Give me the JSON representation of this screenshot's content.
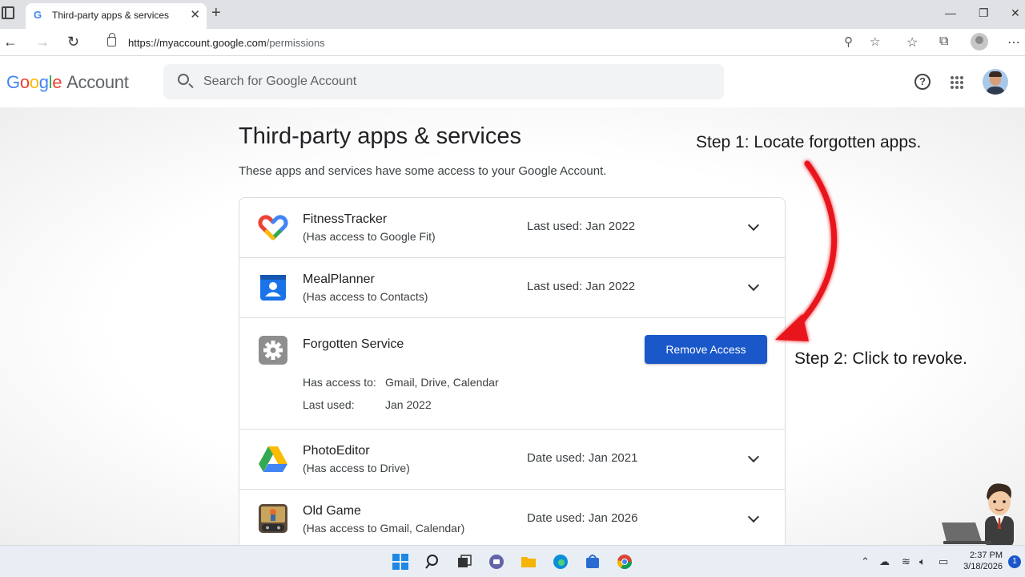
{
  "browser": {
    "tab_title": "Third-party apps & services",
    "tab_favicon": "G",
    "url_host": "https://myaccount.google.com",
    "url_path": "/permissions"
  },
  "header": {
    "logo_google": "Google",
    "logo_account": "Account",
    "search_placeholder": "Search for Google Account",
    "help_icon": "?"
  },
  "page": {
    "title": "Third-party apps & services",
    "subtitle": "These apps and services have some access to your Google Account."
  },
  "apps": [
    {
      "name": "FitnessTracker",
      "access": "(Has access to Google Fit)",
      "used": "Last used: Jan 2022",
      "icon": "google-fit-icon"
    },
    {
      "name": "MealPlanner",
      "access": "(Has access to Contacts)",
      "used": "Last used: Jan 2022",
      "icon": "contacts-icon"
    },
    {
      "name": "Forgotten Service",
      "icon": "gear-icon",
      "access_label": "Has access to:",
      "access_value": "Gmail, Drive, Calendar",
      "used_label": "Last used:",
      "used_value": "Jan 2022",
      "button": "Remove Access"
    },
    {
      "name": "PhotoEditor",
      "access": "(Has access to Drive)",
      "used": "Date used: Jan 2021",
      "icon": "drive-icon"
    },
    {
      "name": "Old Game",
      "access": "(Has access to Gmail, Calendar)",
      "used": "Date used: Jan 2026",
      "icon": "game-icon"
    }
  ],
  "annotations": {
    "step1": "Step 1: Locate forgotten apps.",
    "step2": "Step 2: Click to revoke."
  },
  "taskbar": {
    "time": "2:37 PM",
    "date": "3/18/2026",
    "notifications": "1"
  },
  "colors": {
    "primary_button": "#1a57c9",
    "arrow": "#e8141c"
  }
}
